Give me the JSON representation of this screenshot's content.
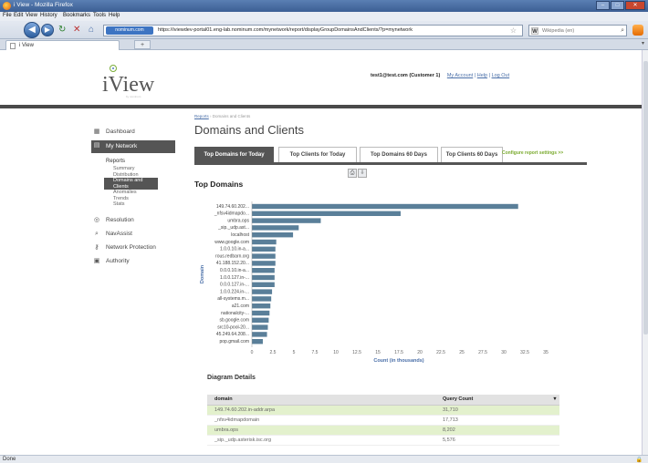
{
  "window": {
    "title": "i View - Mozilla Firefox"
  },
  "menubar": [
    "File",
    "Edit",
    "View",
    "History",
    "Bookmarks",
    "Tools",
    "Help"
  ],
  "browser": {
    "identity_label": "nominum.com",
    "url": "https://iviewdev-portal01.eng-lab.nominum.com/mynetwork/report/displayGroupDomainsAndClients/?p=mynetwork",
    "search_placeholder": "Wikipedia (en)",
    "search_engine_icon": "W",
    "tab_title": "i View",
    "status": "Done"
  },
  "header": {
    "logo_text": "iView",
    "logo_subtext": "by nominum",
    "user": "test1@test.com (Customer 1)",
    "links": [
      "My Account",
      "Help",
      "Log Out"
    ]
  },
  "sidebar": {
    "dashboard": "Dashboard",
    "my_network": "My Network",
    "reports_label": "Reports",
    "report_items": [
      "Summary",
      "Distribution",
      "Domains and Clients",
      "Anomalies",
      "Trends",
      "Stats"
    ],
    "selected_report": "Domains and Clients",
    "resolution": "Resolution",
    "navassist": "NavAssist",
    "network_protection": "Network Protection",
    "authority": "Authority"
  },
  "main": {
    "breadcrumb_link": "Reports",
    "breadcrumb_current": "Domains and Clients",
    "title": "Domains and Clients",
    "tabs": [
      "Top Domains for Today",
      "Top Clients for Today",
      "Top Domains 60 Days",
      "Top Clients 60 Days"
    ],
    "active_tab": 0,
    "configure_link": "Configure report settings >>",
    "chart_heading": "Top Domains",
    "details_heading": "Diagram Details"
  },
  "chart_data": {
    "type": "bar",
    "orientation": "horizontal",
    "ylabel": "Domain",
    "xlabel": "Count (in thousands)",
    "xlim": [
      0,
      35
    ],
    "xticks": [
      0,
      2.5,
      5,
      7.5,
      10,
      12.5,
      15,
      17.5,
      20,
      22.5,
      25,
      27.5,
      30,
      32.5,
      35
    ],
    "categories": [
      "149.74.60.202...",
      "_nfsv4idmapdo...",
      "umbra.ops",
      "_sip._udp.ast...",
      "localhost",
      "www.google.com",
      "1.0.0.10.in-a...",
      "rous.redbarn.org",
      "41.188.152.20...",
      "0.0.0.10.in-a...",
      "1.0.0.127.in-...",
      "0.0.0.127.in-...",
      "1.0.0.224.in-...",
      "all-systems.m...",
      "a21.com",
      "nationalcity-...",
      "sb.google.com",
      "src10-pool-20...",
      "45.249.64.208...",
      "pop.gmail.com"
    ],
    "values": [
      31.71,
      17.713,
      8.202,
      5.576,
      4.9,
      2.9,
      2.8,
      2.8,
      2.8,
      2.7,
      2.7,
      2.7,
      2.4,
      2.3,
      2.2,
      2.1,
      2.0,
      1.9,
      1.8,
      1.3
    ],
    "bar_color": "#5a7f99"
  },
  "table": {
    "headers": [
      "domain",
      "Query Count"
    ],
    "rows": [
      [
        "149.74.60.202.in-addr.arpa",
        "31,710"
      ],
      [
        "_nfsv4idmapdomain",
        "17,713"
      ],
      [
        "umbra.ops",
        "8,202"
      ],
      [
        "_sip._udp.asterisk.isc.org",
        "5,576"
      ]
    ]
  }
}
